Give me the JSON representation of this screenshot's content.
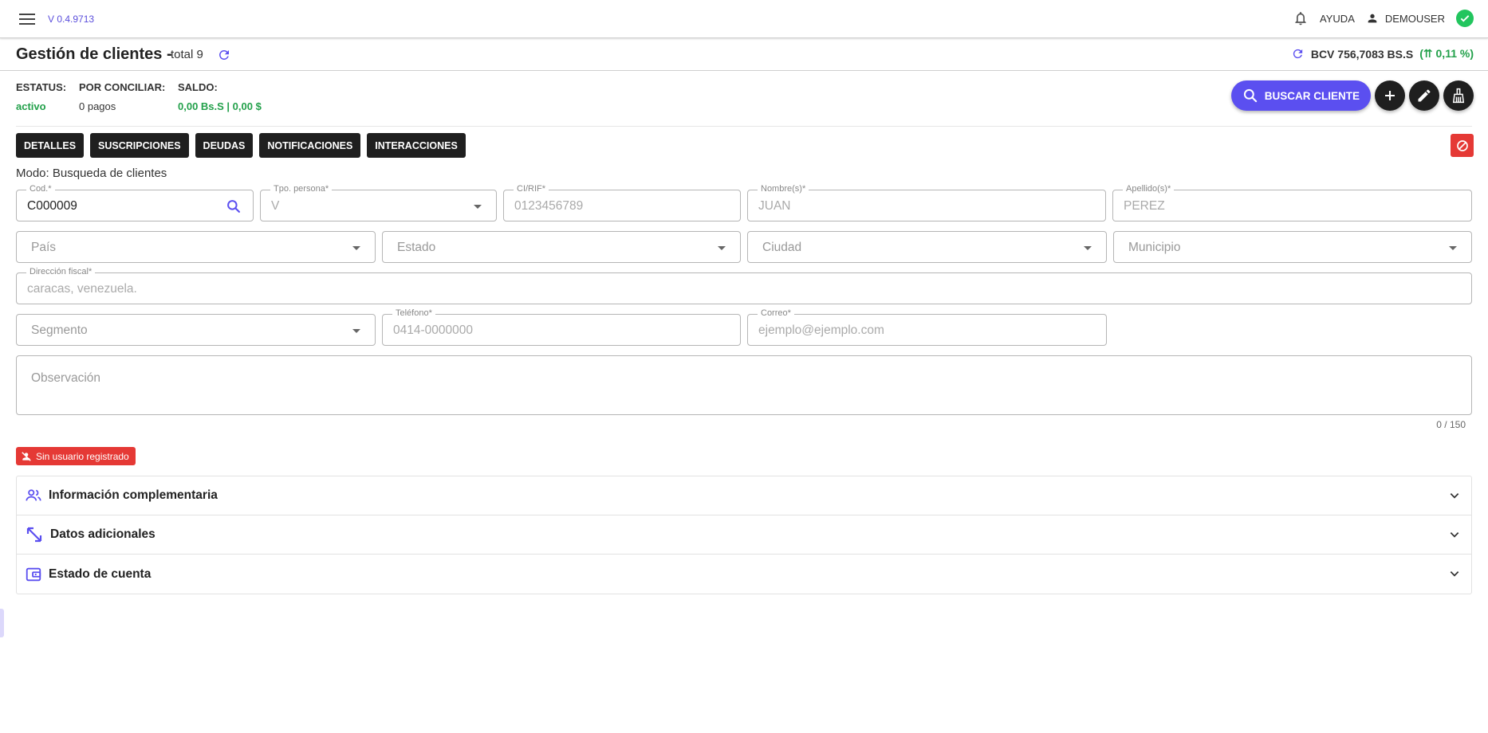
{
  "topbar": {
    "version": "V 0.4.9713",
    "help_label": "AYUDA",
    "user_label": "DEMOUSER"
  },
  "header": {
    "title": "Gestión de clientes -",
    "total": "total 9",
    "bcv_label": "BCV 756,7083 BS.S",
    "bcv_pct": "(⇈ 0,11 %)"
  },
  "status": {
    "estatus_label": "ESTATUS:",
    "estatus_value": "activo",
    "conciliar_label": "POR CONCILIAR:",
    "conciliar_value": "0 pagos",
    "saldo_label": "SALDO:",
    "saldo_value": "0,00 Bs.S | 0,00 $"
  },
  "actions": {
    "search_label": "BUSCAR CLIENTE"
  },
  "tabs": [
    "DETALLES",
    "SUSCRIPCIONES",
    "DEUDAS",
    "NOTIFICACIONES",
    "INTERACCIONES"
  ],
  "mode_text": "Modo: Busqueda de clientes",
  "form": {
    "cod_label": "Cod.*",
    "cod_value": "C000009",
    "tipo_label": "Tpo. persona*",
    "tipo_value": "V",
    "ci_label": "CI/RIF*",
    "ci_placeholder": "0123456789",
    "nombre_label": "Nombre(s)*",
    "nombre_placeholder": "JUAN",
    "apellido_label": "Apellido(s)*",
    "apellido_placeholder": "PEREZ",
    "pais_placeholder": "País",
    "estado_placeholder": "Estado",
    "ciudad_placeholder": "Ciudad",
    "municipio_placeholder": "Municipio",
    "direccion_label": "Dirección fiscal*",
    "direccion_placeholder": "caracas, venezuela.",
    "segmento_placeholder": "Segmento",
    "telefono_label": "Teléfono*",
    "telefono_placeholder": "0414-0000000",
    "correo_label": "Correo*",
    "correo_placeholder": "ejemplo@ejemplo.com",
    "observacion_placeholder": "Observación",
    "observacion_counter": "0 / 150"
  },
  "badge_text": "Sin usuario registrado",
  "accordion": {
    "item1": "Información complementaria",
    "item2": "Datos adicionales",
    "item3": "Estado de cuenta"
  },
  "colors": {
    "accent": "#5b4ff0",
    "success": "#22a04a",
    "danger": "#e53935",
    "dark_button": "#1f1f1f"
  }
}
